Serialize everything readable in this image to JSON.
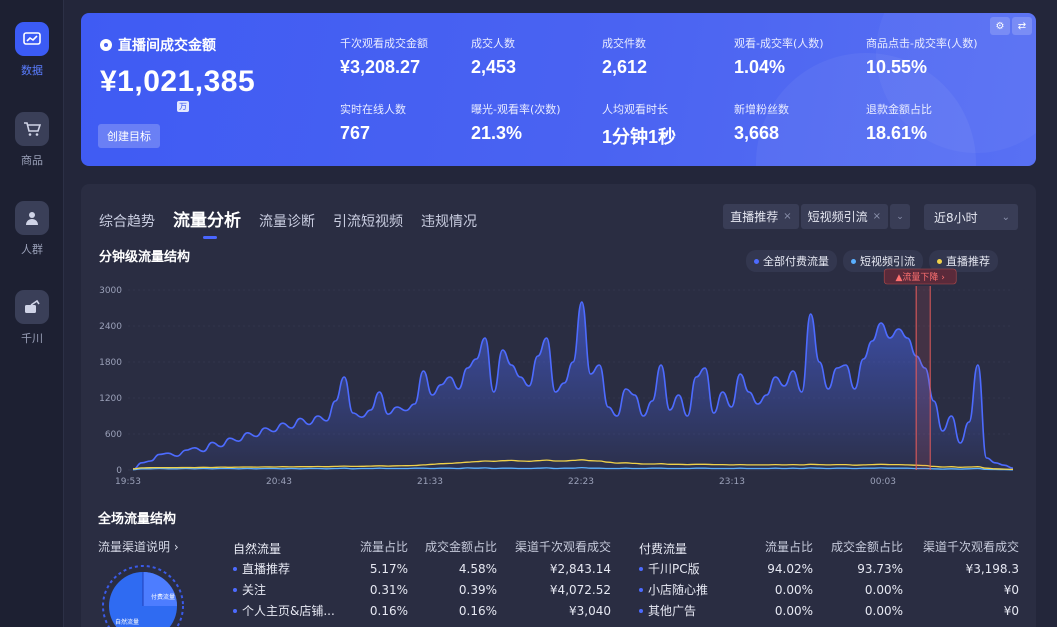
{
  "sidebar": {
    "items": [
      {
        "label": "数据",
        "icon": "chart-icon",
        "active": true
      },
      {
        "label": "商品",
        "icon": "cart-icon",
        "active": false
      },
      {
        "label": "人群",
        "icon": "people-icon",
        "active": false
      },
      {
        "label": "千川",
        "icon": "qianchuan-icon",
        "active": false
      }
    ]
  },
  "banner": {
    "main_title": "直播间成交金额",
    "main_value": "¥1,021,385",
    "unit": "万",
    "create_goal": "创建目标",
    "settings_glyph": "⚙",
    "swap_glyph": "⇄",
    "metrics": [
      {
        "label": "千次观看成交金额",
        "value": "¥3,208.27"
      },
      {
        "label": "成交人数",
        "value": "2,453"
      },
      {
        "label": "成交件数",
        "value": "2,612"
      },
      {
        "label": "观看-成交率(人数)",
        "value": "1.04%"
      },
      {
        "label": "商品点击-成交率(人数)",
        "value": "10.55%"
      },
      {
        "label": "实时在线人数",
        "value": "767"
      },
      {
        "label": "曝光-观看率(次数)",
        "value": "21.3%"
      },
      {
        "label": "人均观看时长",
        "value": "1分钟1秒"
      },
      {
        "label": "新增粉丝数",
        "value": "3,668"
      },
      {
        "label": "退款金额占比",
        "value": "18.61%"
      }
    ]
  },
  "tabs": [
    {
      "label": "综合趋势",
      "active": false
    },
    {
      "label": "流量分析",
      "active": true
    },
    {
      "label": "流量诊断",
      "active": false
    },
    {
      "label": "引流短视频",
      "active": false
    },
    {
      "label": "违规情况",
      "active": false
    }
  ],
  "filters": {
    "chips": [
      "直播推荐",
      "短视频引流"
    ],
    "remove_glyph": "×",
    "caret_glyph": "⌄",
    "time_range": "近8小时"
  },
  "chart_section_title": "分钟级流量结构",
  "legend": [
    {
      "label": "全部付费流量",
      "color": "#4d6bff"
    },
    {
      "label": "短视频引流",
      "color": "#5ab0ff"
    },
    {
      "label": "直播推荐",
      "color": "#f0d24a"
    }
  ],
  "chart_data": {
    "type": "line",
    "ylim": [
      0,
      3000
    ],
    "yticks": [
      0,
      600,
      1200,
      1800,
      2400,
      3000
    ],
    "xtick_labels": [
      "19:53",
      "20:43",
      "21:33",
      "22:23",
      "23:13",
      "00:03"
    ],
    "annotation": "流量下降",
    "series": [
      {
        "name": "全部付费流量",
        "color": "#4d6bff",
        "area": true,
        "values": [
          10,
          120,
          150,
          260,
          280,
          230,
          330,
          370,
          310,
          460,
          390,
          530,
          480,
          620,
          560,
          700,
          640,
          780,
          700,
          860,
          760,
          900,
          820,
          1150,
          1550,
          950,
          880,
          1000,
          1300,
          930,
          1050,
          990,
          1100,
          1650,
          1250,
          1420,
          1550,
          1350,
          1700,
          1850,
          2200,
          1300,
          2000,
          1750,
          1550,
          1400,
          1900,
          2200,
          1300,
          1450,
          1800,
          2800,
          1600,
          1750,
          1050,
          900,
          1350,
          1250,
          900,
          1150,
          1750,
          1000,
          1250,
          900,
          1550,
          1700,
          950,
          1300,
          1050,
          1600,
          1300,
          1100,
          1250,
          1550,
          1400,
          1650,
          1300,
          2600,
          1800,
          1350,
          1700,
          1750,
          1350,
          1850,
          2150,
          2450,
          2200,
          2350,
          2200,
          1900,
          1700,
          1150,
          650,
          900,
          450,
          800,
          1750,
          200,
          120,
          80,
          30
        ]
      },
      {
        "name": "短视频引流",
        "color": "#5ab0ff",
        "area": false,
        "values": [
          5,
          20,
          20,
          25,
          20,
          20,
          25,
          20,
          25,
          20,
          25,
          25,
          20,
          25,
          20,
          25,
          25,
          20,
          25,
          20,
          25,
          25,
          20,
          25,
          30,
          20,
          25,
          25,
          30,
          25,
          25,
          25,
          30,
          30,
          25,
          30,
          30,
          25,
          35,
          30,
          35,
          25,
          30,
          30,
          25,
          25,
          30,
          35,
          25,
          30,
          30,
          40,
          30,
          30,
          25,
          25,
          30,
          25,
          25,
          30,
          30,
          25,
          25,
          25,
          30,
          30,
          25,
          25,
          25,
          30,
          25,
          25,
          25,
          30,
          25,
          30,
          25,
          35,
          30,
          25,
          30,
          30,
          25,
          30,
          30,
          35,
          30,
          30,
          30,
          25,
          25,
          20,
          15,
          20,
          15,
          20,
          25,
          10,
          8,
          6,
          4
        ]
      },
      {
        "name": "直播推荐",
        "color": "#f0d24a",
        "area": false,
        "values": [
          20,
          35,
          38,
          40,
          38,
          40,
          42,
          40,
          45,
          42,
          48,
          45,
          48,
          50,
          48,
          52,
          50,
          55,
          52,
          55,
          55,
          58,
          55,
          60,
          65,
          60,
          62,
          65,
          70,
          65,
          70,
          72,
          75,
          85,
          95,
          105,
          110,
          120,
          130,
          140,
          150,
          145,
          155,
          160,
          150,
          145,
          155,
          165,
          150,
          150,
          160,
          170,
          155,
          150,
          130,
          115,
          120,
          110,
          100,
          100,
          105,
          95,
          95,
          90,
          95,
          95,
          90,
          90,
          85,
          90,
          85,
          85,
          85,
          90,
          85,
          90,
          85,
          95,
          90,
          85,
          90,
          90,
          80,
          85,
          90,
          95,
          90,
          90,
          85,
          80,
          75,
          60,
          50,
          55,
          45,
          50,
          55,
          30,
          20,
          15,
          10
        ]
      }
    ]
  },
  "bottom": {
    "title": "全场流量结构",
    "channel_link": "流量渠道说明 ›",
    "donut_labels": [
      "自然流量",
      "付费流量"
    ],
    "natural": {
      "headers": [
        "自然流量",
        "流量占比",
        "成交金额占比",
        "渠道千次观看成交"
      ],
      "rows": [
        [
          "直播推荐",
          "5.17%",
          "4.58%",
          "¥2,843.14"
        ],
        [
          "关注",
          "0.31%",
          "0.39%",
          "¥4,072.52"
        ],
        [
          "个人主页&店铺...",
          "0.16%",
          "0.16%",
          "¥3,040"
        ]
      ]
    },
    "paid": {
      "headers": [
        "付费流量",
        "流量占比",
        "成交金额占比",
        "渠道千次观看成交"
      ],
      "rows": [
        [
          "千川PC版",
          "94.02%",
          "93.73%",
          "¥3,198.3"
        ],
        [
          "小店随心推",
          "0.00%",
          "0.00%",
          "¥0"
        ],
        [
          "其他广告",
          "0.00%",
          "0.00%",
          "¥0"
        ]
      ]
    }
  }
}
